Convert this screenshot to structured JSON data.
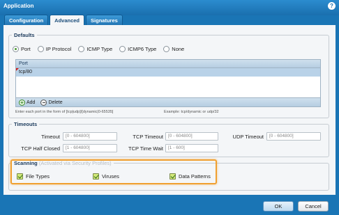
{
  "dialog": {
    "title": "Application"
  },
  "tabs": [
    {
      "label": "Configuration"
    },
    {
      "label": "Advanced"
    },
    {
      "label": "Signatures"
    }
  ],
  "defaults": {
    "legend": "Defaults",
    "radio_options": [
      "Port",
      "IP Protocol",
      "ICMP Type",
      "ICMP6 Type",
      "None"
    ],
    "selected": "Port",
    "grid": {
      "column": "Port",
      "rows": [
        "tcp/80"
      ],
      "add_label": "Add",
      "delete_label": "Delete"
    },
    "hint_left": "Enter each port in the form of [tcp|udp]/[dynamic|0-65535]",
    "hint_right": "Example: tcp/dynamic or udp/32"
  },
  "timeouts": {
    "legend": "Timeouts",
    "timeout_label": "Timeout",
    "timeout_placeholder": "[0 - 604800]",
    "tcp_timeout_label": "TCP Timeout",
    "tcp_timeout_placeholder": "[0 - 604800]",
    "udp_timeout_label": "UDP Timeout",
    "udp_timeout_placeholder": "[0 - 604800]",
    "tcp_half_closed_label": "TCP Half Closed",
    "tcp_half_closed_placeholder": "[1 - 604800]",
    "tcp_time_wait_label": "TCP Time Wait",
    "tcp_time_wait_placeholder": "[1 - 600]"
  },
  "scanning": {
    "legend": "Scanning",
    "legend_note": "(Activated via Security Profiles)",
    "items": [
      {
        "label": "File Types",
        "checked": true
      },
      {
        "label": "Viruses",
        "checked": true
      },
      {
        "label": "Data Patterns",
        "checked": true
      }
    ]
  },
  "footer": {
    "ok_label": "OK",
    "cancel_label": "Cancel"
  },
  "colors": {
    "titlebar": "#1a75b5",
    "highlight": "#f0a030",
    "checkbox": "#d2e87a"
  }
}
